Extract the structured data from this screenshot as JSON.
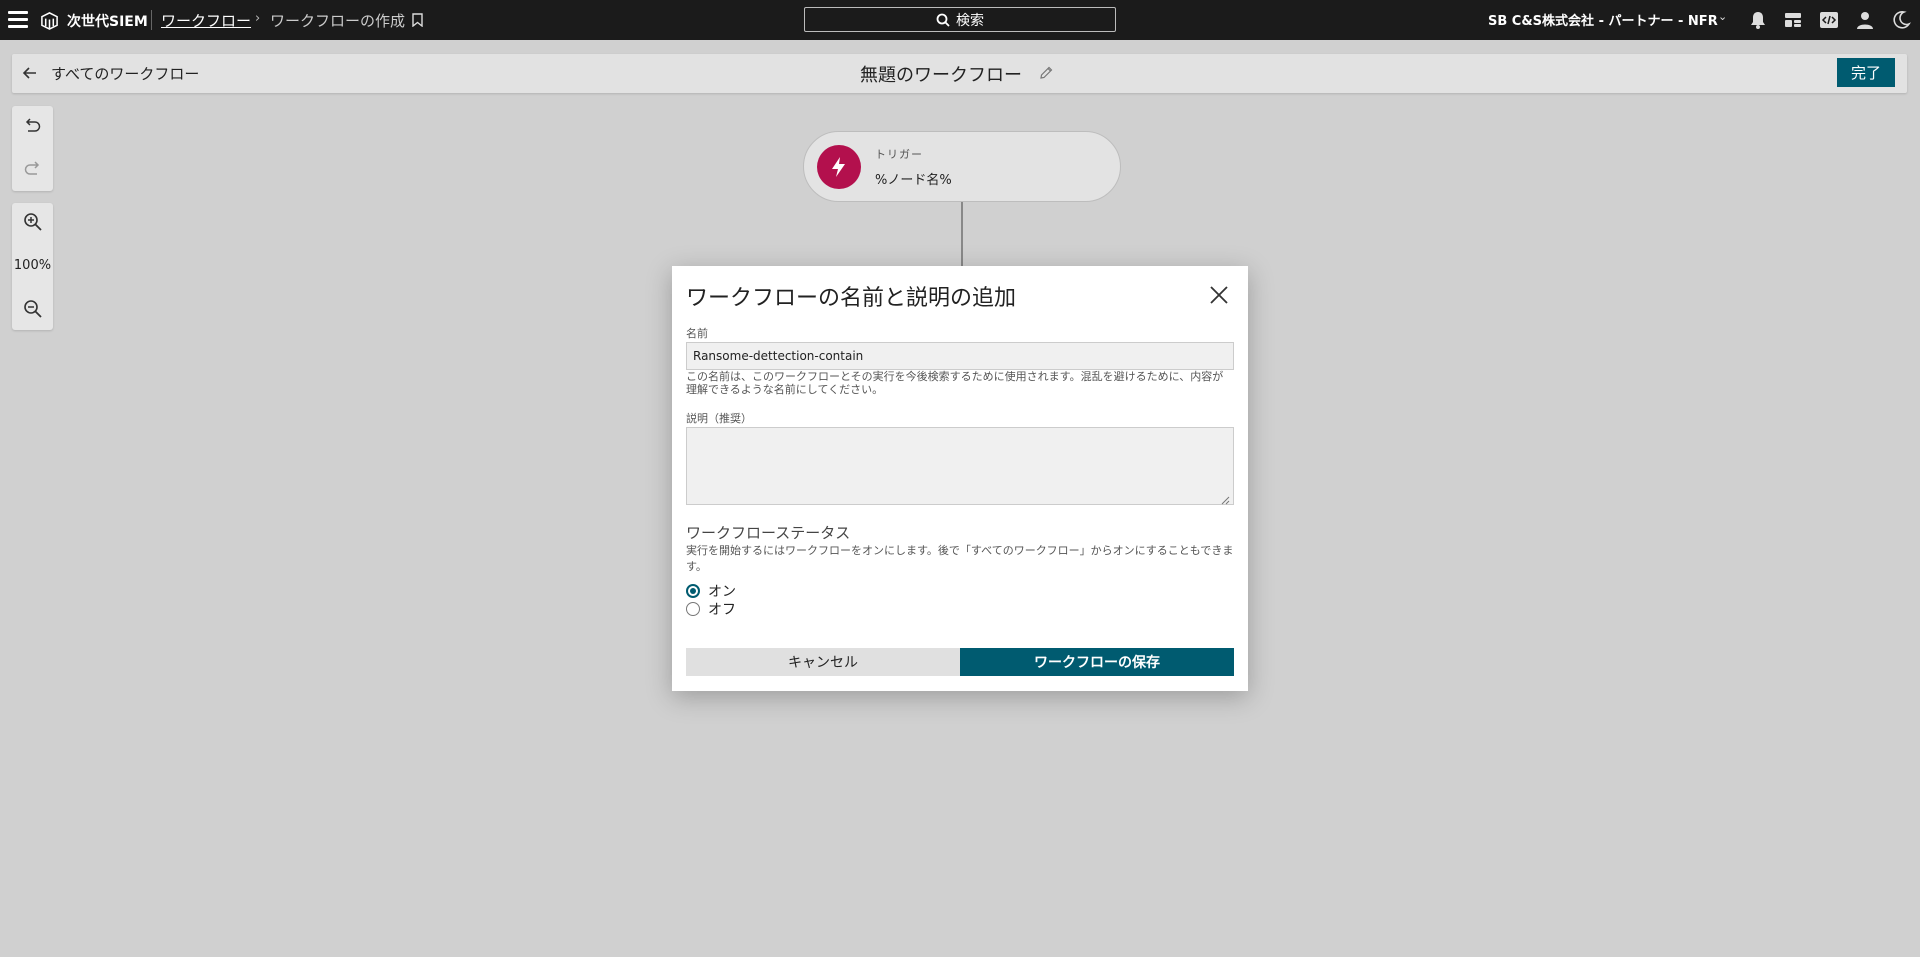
{
  "topnav": {
    "product_name": "次世代SIEM",
    "breadcrumb_link": "ワークフロー",
    "breadcrumb_separator": "›",
    "breadcrumb_current": "ワークフローの作成",
    "search_label": "検索",
    "tenant_name": "SB C&S株式会社 - パートナー - NFR",
    "tenant_chevron": "⌄",
    "icons": [
      "bell-icon",
      "dashboard-icon",
      "code-icon",
      "user-icon",
      "moon-icon"
    ]
  },
  "subheader": {
    "back_label": "すべてのワークフロー",
    "workflow_title": "無題のワークフロー",
    "done_label": "完了"
  },
  "toolbar": {
    "zoom_level": "100%"
  },
  "canvas": {
    "trigger_kind": "トリガー",
    "trigger_name": "%ノード名%",
    "trigger_color": "#b3104d"
  },
  "modal": {
    "title": "ワークフローの名前と説明の追加",
    "name_label": "名前",
    "name_value": "Ransome-dettection-contain",
    "name_hint": "この名前は、このワークフローとその実行を今後検索するために使用されます。混乱を避けるために、内容が理解できるような名前にしてください。",
    "description_label": "説明（推奨）",
    "description_value": "",
    "status_title": "ワークフローステータス",
    "status_hint": "実行を開始するにはワークフローをオンにします。後で「すべてのワークフロー」からオンにすることもできます。",
    "status_on_label": "オン",
    "status_off_label": "オフ",
    "selected_status": "オン",
    "cancel_label": "キャンセル",
    "save_label": "ワークフローの保存"
  },
  "colors": {
    "accent": "#005b70",
    "topnav_bg": "#1b1b1b",
    "canvas_bg": "#d0d0d0"
  }
}
